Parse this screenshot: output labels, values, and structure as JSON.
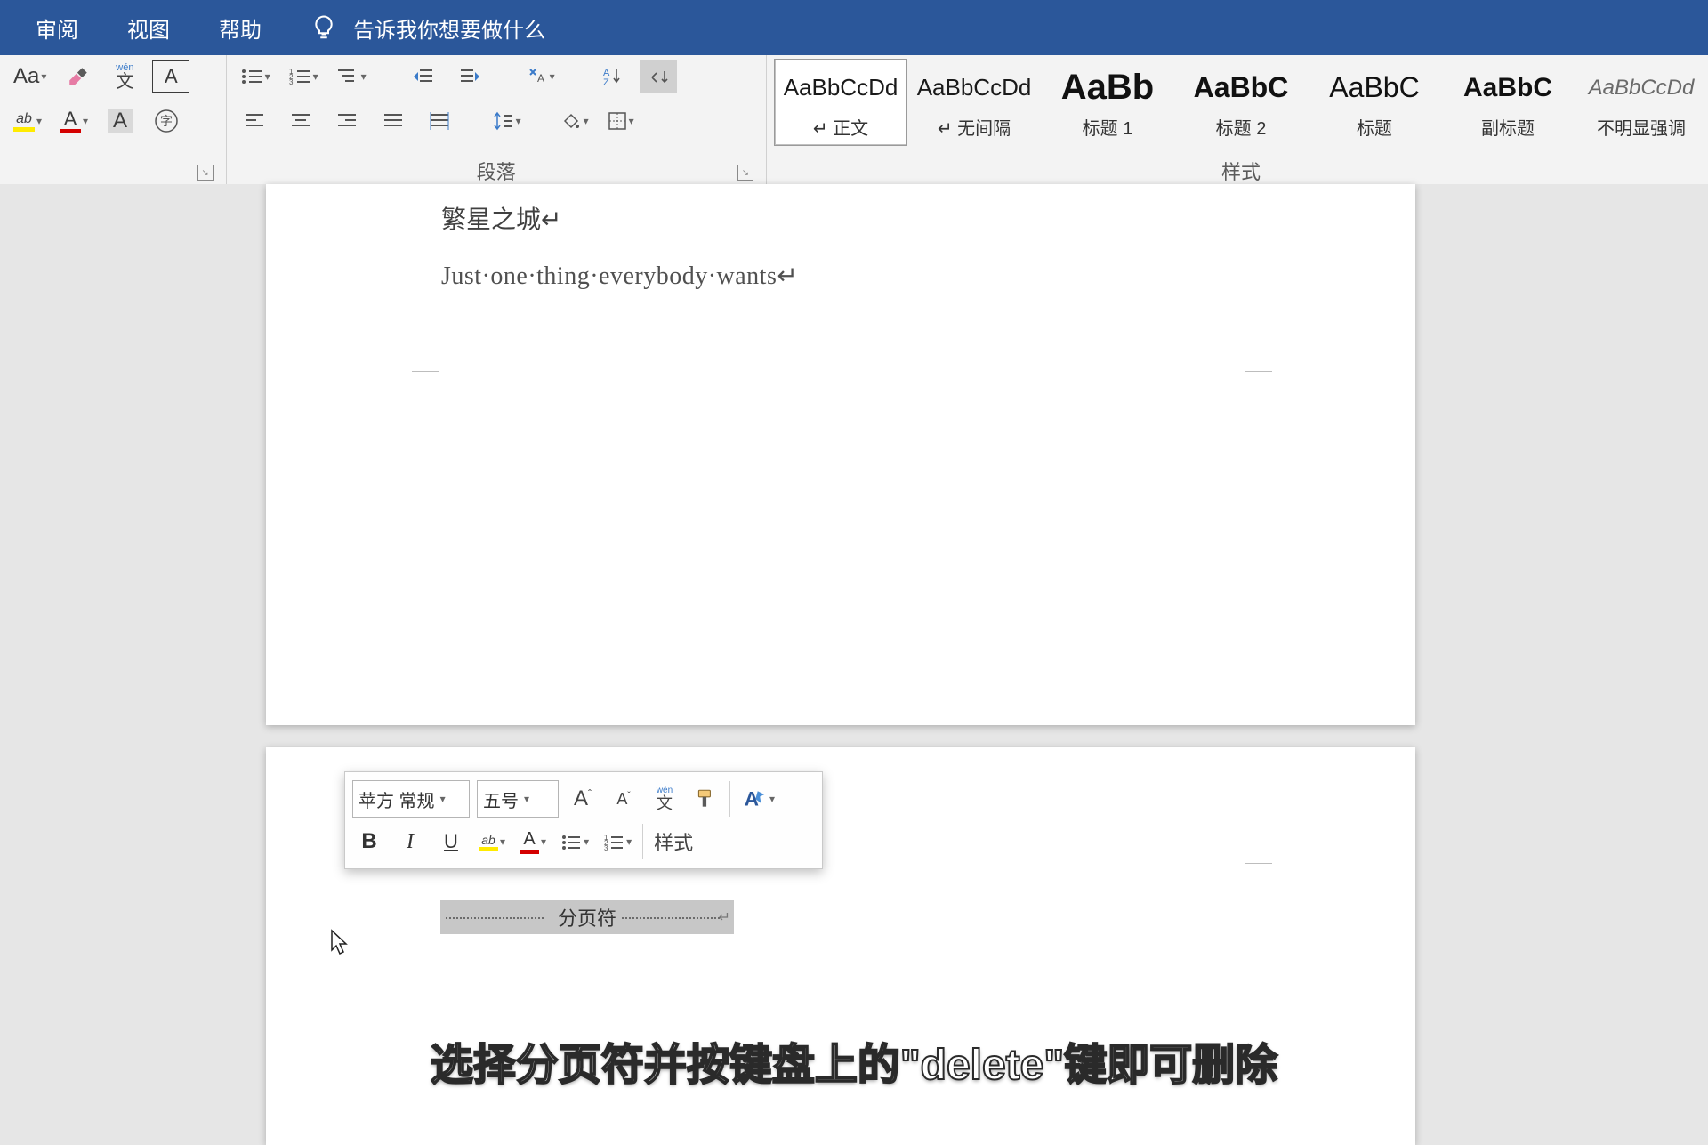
{
  "tabs": {
    "review": "审阅",
    "view": "视图",
    "help": "帮助",
    "tell_me": "告诉我你想要做什么"
  },
  "groups": {
    "paragraph": "段落",
    "styles": "样式"
  },
  "font_row1": {
    "change_case": "Aa",
    "phonetic": "wén 文",
    "char_border": "A"
  },
  "styles_gallery": [
    {
      "preview": "AaBbCcDd",
      "name": "↵ 正文",
      "selected": true,
      "size": 26,
      "weight": 400,
      "italic": false,
      "color": "#1a1a1a"
    },
    {
      "preview": "AaBbCcDd",
      "name": "↵ 无间隔",
      "selected": false,
      "size": 26,
      "weight": 400,
      "italic": false,
      "color": "#1a1a1a"
    },
    {
      "preview": "AaBb",
      "name": "标题 1",
      "selected": false,
      "size": 40,
      "weight": 600,
      "italic": false,
      "color": "#111"
    },
    {
      "preview": "AaBbC",
      "name": "标题 2",
      "selected": false,
      "size": 32,
      "weight": 600,
      "italic": false,
      "color": "#111"
    },
    {
      "preview": "AaBbC",
      "name": "标题",
      "selected": false,
      "size": 32,
      "weight": 500,
      "italic": false,
      "color": "#111"
    },
    {
      "preview": "AaBbC",
      "name": "副标题",
      "selected": false,
      "size": 30,
      "weight": 600,
      "italic": false,
      "color": "#111"
    },
    {
      "preview": "AaBbCcDd",
      "name": "不明显强调",
      "selected": false,
      "size": 24,
      "weight": 400,
      "italic": true,
      "color": "#6a6a6a"
    }
  ],
  "document": {
    "line1": "繁星之城↵",
    "line2": "Just·one·thing·everybody·wants↵",
    "page_break_label": "分页符"
  },
  "mini_toolbar": {
    "font_name": "苹方 常规",
    "font_size": "五号",
    "styles_label": "样式"
  },
  "caption": "选择分页符并按键盘上的\"delete\"键即可删除"
}
